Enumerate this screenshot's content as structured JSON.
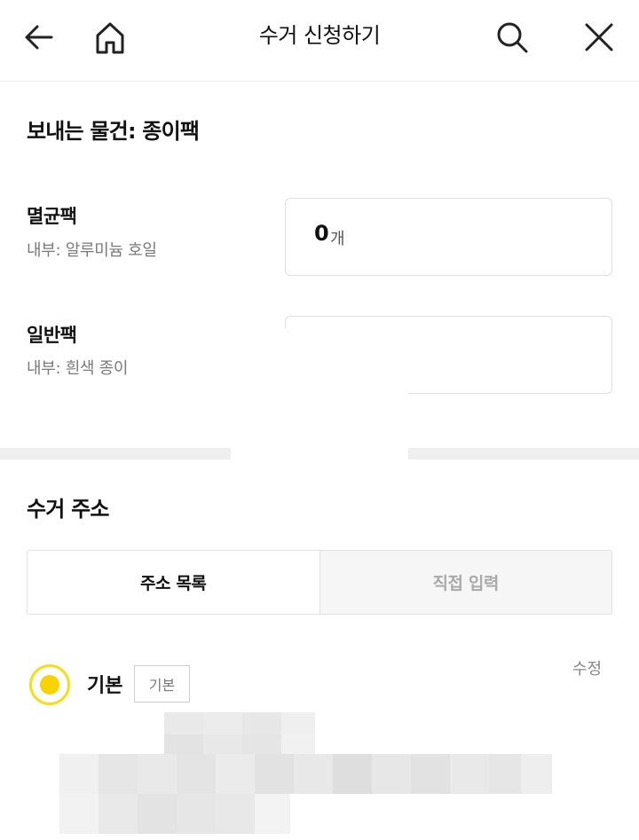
{
  "header": {
    "title": "수거 신청하기",
    "back_icon": "back-arrow-icon",
    "home_icon": "home-icon",
    "search_icon": "search-icon",
    "close_icon": "close-icon"
  },
  "items_section": {
    "title": "보내는 물건: 종이팩",
    "packs": [
      {
        "name": "멸균팩",
        "desc": "내부: 알루미늄 호일",
        "quantity": "0",
        "unit": "개"
      },
      {
        "name": "일반팩",
        "desc": "내부: 흰색 종이",
        "quantity": "",
        "unit": ""
      }
    ]
  },
  "address_section": {
    "title": "수거 주소",
    "tabs": [
      {
        "label": "주소 목록",
        "active": true
      },
      {
        "label": "직접 입력",
        "active": false
      }
    ],
    "selected_address": {
      "name": "기본",
      "badge": "기본",
      "edit_label": "수정"
    }
  },
  "colors": {
    "accent": "#f7d400",
    "divider": "#efefef",
    "muted_text": "#7a7a7a"
  }
}
